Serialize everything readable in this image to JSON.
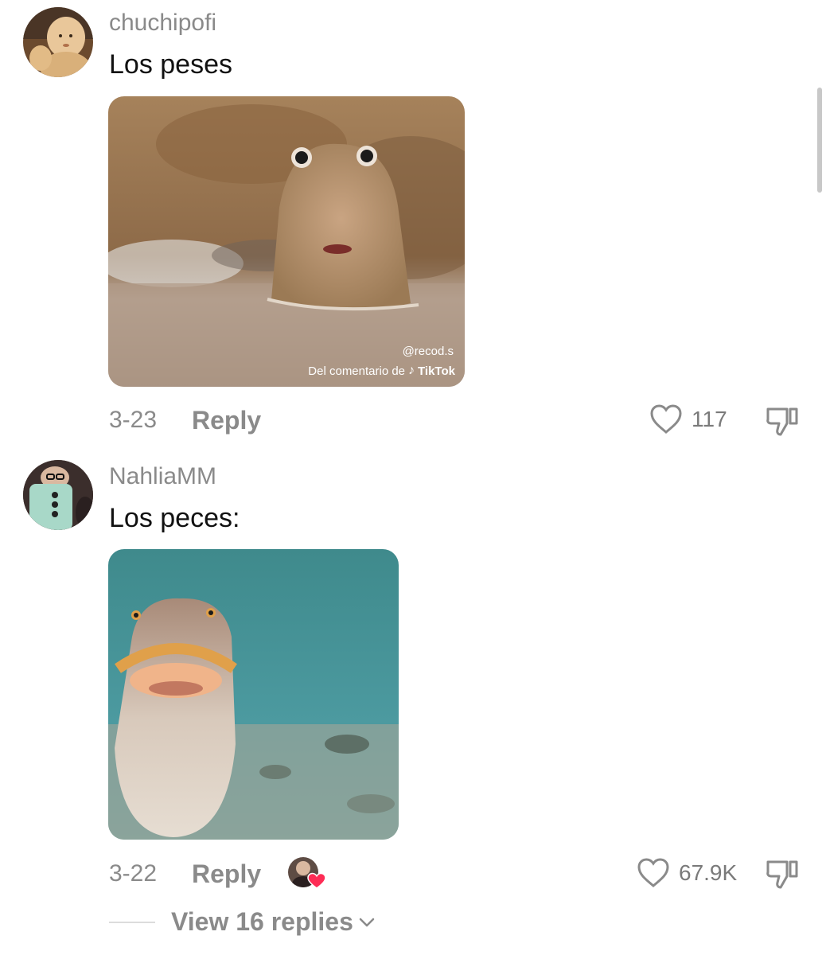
{
  "comments": [
    {
      "username": "chuchipofi",
      "text": "Los peses",
      "date": "3-23",
      "reply_label": "Reply",
      "like_count": "117",
      "media": {
        "watermark_handle": "@recod.s",
        "watermark_caption": "Del comentario de",
        "watermark_brand": "TikTok"
      }
    },
    {
      "username": "NahliaMM",
      "text": "Los peces:",
      "date": "3-22",
      "reply_label": "Reply",
      "like_count": "67.9K",
      "view_replies": "View 16 replies"
    }
  ],
  "icons": {
    "like": "heart-outline-icon",
    "dislike": "thumbs-down-icon",
    "expand": "chevron-down-icon",
    "creator_liked": "heart-badge-icon"
  },
  "colors": {
    "secondary_text": "#8a8a8a",
    "creator_heart": "#fe2c55"
  }
}
